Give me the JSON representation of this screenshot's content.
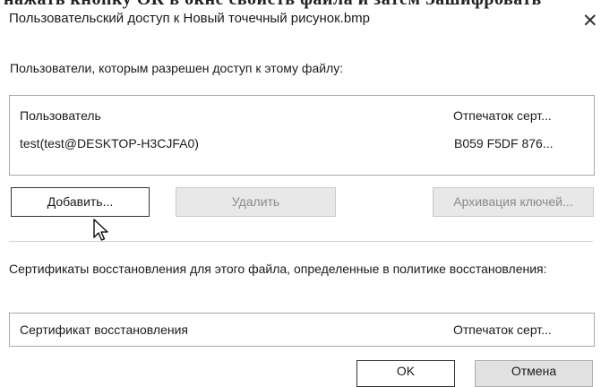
{
  "top_clip_text": "нажать кнопку ОК в окне свойств файла и затем Зашифровать содержимое для защиты данных.",
  "window": {
    "title": "Пользовательский доступ к Новый точечный рисунок.bmp",
    "close_glyph": "✕"
  },
  "users_section": {
    "label": "Пользователи, которым разрешен доступ к этому файлу:",
    "columns": [
      "Пользователь",
      "Отпечаток серт..."
    ],
    "rows": [
      {
        "user": "test(test@DESKTOP-H3CJFA0)",
        "thumbprint": "B059 F5DF 876..."
      }
    ]
  },
  "buttons": {
    "add": "Добавить...",
    "remove": "Удалить",
    "backup_keys": "Архивация ключей..."
  },
  "recovery_section": {
    "label": "Сертификаты восстановления для этого файла, определенные в политике восстановления:",
    "columns": [
      "Сертификат восстановления",
      "Отпечаток серт..."
    ]
  },
  "footer": {
    "ok": "OK",
    "cancel": "Отмена"
  },
  "icons": {
    "close": "close-icon",
    "cursor": "mouse-pointer-icon"
  }
}
